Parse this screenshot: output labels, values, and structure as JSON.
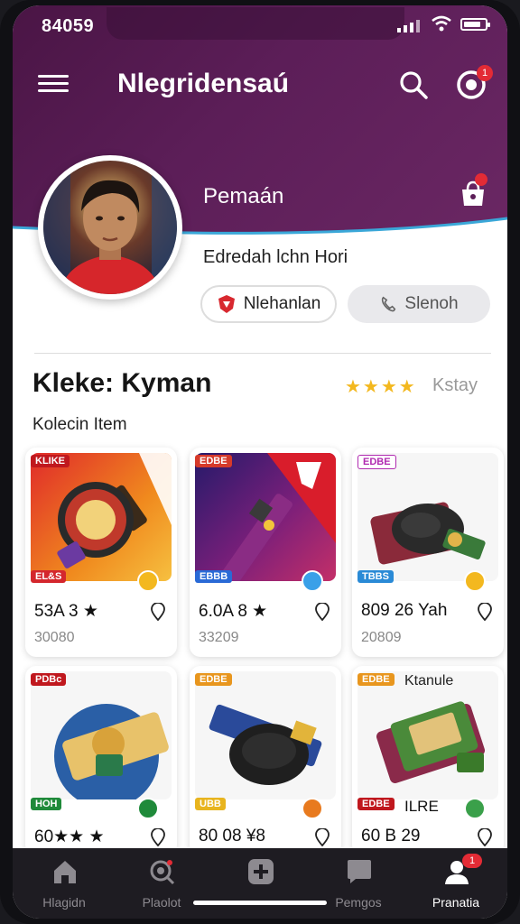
{
  "status": {
    "time": "84059"
  },
  "header": {
    "title": "Nlegridensaú",
    "notif_badge": "1"
  },
  "profile": {
    "name": "Pemaán",
    "subtitle": "Edredah lchn Hori",
    "primary_button": "Nlehanlan",
    "secondary_button": "Slenoh"
  },
  "section": {
    "title": "Kleke: Kyman",
    "stars": "★★★★",
    "rating_label": "Kstay",
    "subtitle": "Kolecin Item"
  },
  "items": [
    {
      "tag": "KLIKE",
      "tag2": "EL&S",
      "price": "53A 3 ★",
      "count": "30080",
      "accent": "#e8501f"
    },
    {
      "tag": "EDBE",
      "tag2": "EBBB",
      "price": "6.0A 8 ★",
      "count": "33209",
      "accent": "#2a1f7a"
    },
    {
      "tag": "EDBE",
      "tag2": "TBBS",
      "price": "809 26 Yah",
      "count": "20809",
      "accent": "#f2f2f2"
    },
    {
      "tag": "PDBc",
      "tag2": "HOH",
      "price": "60★★ ★",
      "count": "",
      "accent": "#dfe6ef"
    },
    {
      "tag": "EDBE",
      "tag2": "UBB",
      "price": "80 08 ¥8",
      "count": "",
      "accent": "#f2f2f2"
    },
    {
      "tag": "EDBE",
      "tag_extra": "Ktanule",
      "tag2": "EDBE",
      "price_extra": "ILRE",
      "price": "60 B 29",
      "count": "",
      "accent": "#f2f2f2"
    }
  ],
  "tabs": [
    {
      "label": "Hlagidn",
      "icon": "home-icon"
    },
    {
      "label": "Plaolot",
      "icon": "explore-icon"
    },
    {
      "label": "",
      "icon": "add-icon"
    },
    {
      "label": "Pemgos",
      "icon": "chat-icon"
    },
    {
      "label": "Pranatia",
      "icon": "profile-icon",
      "badge": "1"
    }
  ]
}
